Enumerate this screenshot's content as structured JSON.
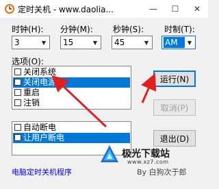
{
  "window": {
    "title": "定时关机 - www.daolia...",
    "min_glyph": "—",
    "max_glyph": "☐",
    "close_glyph": "✕"
  },
  "time": {
    "hour_label": "时钟(H):",
    "hour_value": "3",
    "minute_label": "分钟(M):",
    "minute_value": "15",
    "second_label": "秒钟(S):",
    "second_value": "45",
    "format_label": "时制(T):",
    "format_value": "AM"
  },
  "options": {
    "label": "选项(O):",
    "items": [
      {
        "label": "关闭系统",
        "checked": false,
        "selected": false
      },
      {
        "label": "关闭电源",
        "checked": true,
        "selected": true
      },
      {
        "label": "重启",
        "checked": false,
        "selected": false
      },
      {
        "label": "注销",
        "checked": false,
        "selected": false
      }
    ]
  },
  "extra": {
    "items": [
      {
        "label": "自动断电",
        "checked": false,
        "selected": false
      },
      {
        "label": "让用户断电",
        "checked": true,
        "selected": true
      }
    ]
  },
  "buttons": {
    "run": "运行(N)",
    "cancel": "取消(P)",
    "exit": "退出(D)"
  },
  "footer": {
    "program_link": "电脑定时关机程序",
    "author": "By 白狗次于郎"
  },
  "watermark": {
    "name": "极光下载站",
    "url": "www.xz7.com"
  },
  "colors": {
    "selection": "#0078d7",
    "arrow": "#e02020",
    "link": "#0000ff"
  }
}
